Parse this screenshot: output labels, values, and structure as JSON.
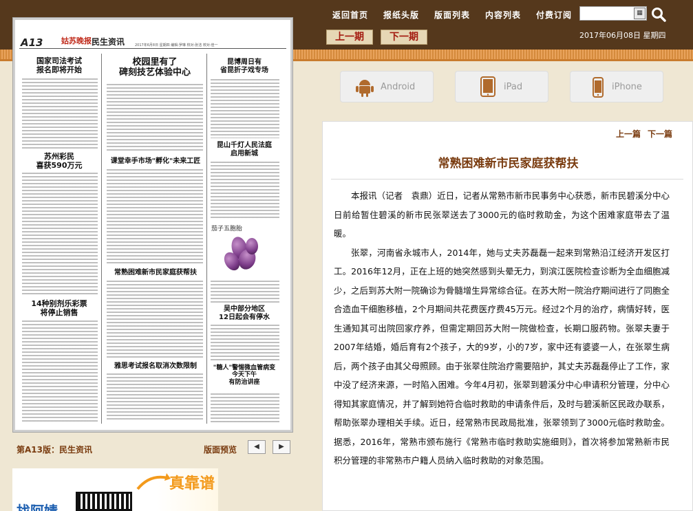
{
  "nav": {
    "home": "返回首页",
    "headline": "报纸头版",
    "pages": "版面列表",
    "contents": "内容列表",
    "subscribe": "付费订阅",
    "search_placeholder": "",
    "prev_issue": "上一期",
    "next_issue": "下一期",
    "date": "2017年06月08日 星期四"
  },
  "apps": [
    "Android",
    "iPad",
    "iPhone"
  ],
  "page": {
    "number": "A13",
    "brand": "姑苏晚报",
    "section": "民生资讯",
    "dateline": "2017年6月8日 星期四 编辑:罗琳 校对:张洁 校对:佳一",
    "headlines": {
      "h1": "国家司法考试\n报名即将开始",
      "h2": "校园里有了\n碑刻技艺体验中心",
      "h3": "昆博周日有\n省昆折子戏专场",
      "h4": "苏州彩民\n喜获590万元",
      "h5": "昆山千灯人民法庭\n启用新城",
      "h6": "课堂幸手市场\"孵化\"未来工匠",
      "h7": "茄子五胞胎",
      "h8": "常熟困难新市民家庭获帮扶",
      "h9": "14种别剂乐彩票\n将停止销售",
      "h10": "吴中部分地区\n12日起会有停水",
      "h11": "雅思考试报名取消次数限制",
      "h12": "\"糖人\"警惕微血管病变\n今天下午\n有防治讲座"
    }
  },
  "pager": {
    "label": "第A13版：民生资讯",
    "preview": "版面预览",
    "prev_icon": "◀",
    "next_icon": "▶"
  },
  "ad": {
    "slogan": "真靠谱",
    "text": "找阿婧"
  },
  "article": {
    "prev": "上一篇",
    "next": "下一篇",
    "title": "常熟困难新市民家庭获帮扶",
    "paragraphs": [
      "本报讯（记者　袁鼎）近日，记者从常熟市新市民事务中心获悉，新市民碧溪分中心日前给暂住碧溪的新市民张翠送去了3000元的临时救助金，为这个困难家庭带去了温暖。",
      "张翠，河南省永城市人，2014年，她与丈夫苏磊磊一起来到常熟沿江经济开发区打工。2016年12月，正在上班的她突然感到头晕无力，到滨江医院检查诊断为全血细胞减少，之后到苏大附一院确诊为骨髓增生异常综合征。在苏大附一院治疗期间进行了同胞全合造血干细胞移植，2个月期间共花费医疗费45万元。经过2个月的治疗，病情好转，医生通知其可出院回家疗养，但需定期回苏大附一院做检查，长期口服药物。张翠夫妻于2007年结婚，婚后育有2个孩子，大的9岁，小的7岁，家中还有婆婆一人，在张翠生病后，两个孩子由其父母照顾。由于张翠住院治疗需要陪护，其丈夫苏磊磊停止了工作，家中没了经济来源，一时陷入困难。今年4月初，张翠到碧溪分中心申请积分管理，分中心得知其家庭情况，并了解到她符合临时救助的申请条件后，及时与碧溪新区民政办联系，帮助张翠办理相关手续。近日，经常熟市民政局批准，张翠领到了3000元临时救助金。据悉，2016年，常熟市颁布施行《常熟市临时救助实施细则》，首次将参加常熟新市民积分管理的非常熟市户籍人员纳入临时救助的对象范围。"
    ]
  }
}
